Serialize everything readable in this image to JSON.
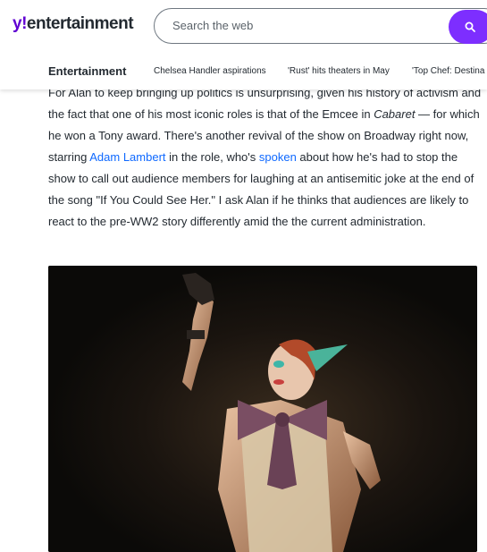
{
  "header": {
    "logo": {
      "prefix": "y",
      "bang": "!",
      "word": "entertainment"
    },
    "search": {
      "placeholder": "Search the web",
      "button_icon": "search-icon"
    },
    "accent_color": "#7d2eff"
  },
  "nav": {
    "title": "Entertainment",
    "links": [
      "Chelsea Handler aspirations",
      "'Rust' hits theaters in May",
      "'Top Chef: Destina"
    ]
  },
  "article": {
    "p1": "For Alan to keep bringing up politics is unsurprising, given his history of activism and the fact that one of his most iconic roles is that of the Emcee in ",
    "p2_italic": "Cabaret",
    "p3": " — for which he won a Tony award. There's another revival of the show on Broadway right now, starring ",
    "link1": "Adam Lambert",
    "p4": " in the role, who's ",
    "link2": "spoken",
    "p5": " about how he's had to stop the show to call out audience members for laughing at an antisemitic joke at the end of the song \"If You Could See Her.\" I ask Alan if he thinks that audiences are likely to react to the pre-WW2 story differently amid the the current administration."
  },
  "photo": {
    "subject": "performer-photo"
  }
}
